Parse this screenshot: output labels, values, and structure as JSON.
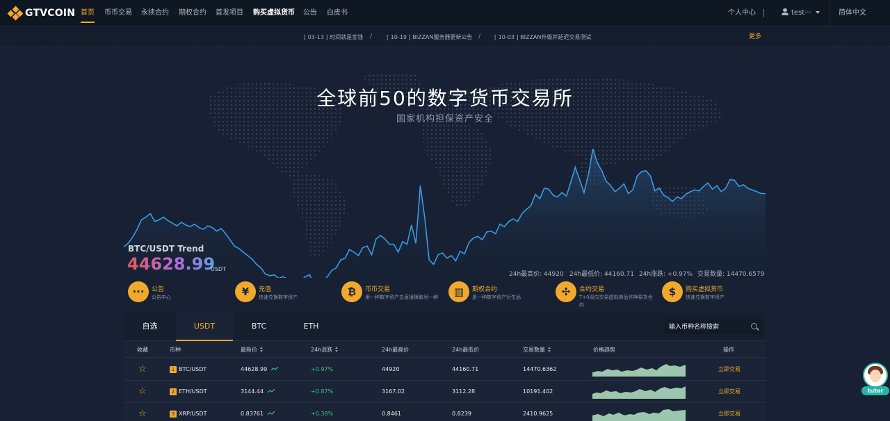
{
  "brand": {
    "name": "GTVCOIN"
  },
  "nav": {
    "items": [
      {
        "label": "首页"
      },
      {
        "label": "币币交易"
      },
      {
        "label": "永续合约"
      },
      {
        "label": "期权合约"
      },
      {
        "label": "首发项目"
      },
      {
        "label": "购买虚拟货币"
      },
      {
        "label": "公告"
      },
      {
        "label": "白皮书"
      }
    ],
    "personal_center": "个人中心",
    "user": "test···",
    "language": "简体中文"
  },
  "notices": {
    "items": [
      "[ 03-13 ] 时间就是金钱",
      "[ 10-19 ] BIZZAN服务器更新公告",
      "[ 10-03 ] BIZZAN升级并延迟交易测试"
    ],
    "separator": "/",
    "more": "更多"
  },
  "hero": {
    "title": "全球前50的数字货币交易所",
    "subtitle": "国家机构担保资产安全"
  },
  "trend": {
    "label": "BTC/USDT Trend",
    "price": "44628.99",
    "unit": "USDT",
    "high": "24h最高价: 44920",
    "low": "24h最低价: 44160.71",
    "change": "24h涨跌: +0.97%",
    "volume": "交易数量: 14470.6579",
    "line_color": "#3a9be3",
    "points": [
      1.8,
      2.2,
      2.9,
      3.8,
      4.9,
      5.2,
      5.6,
      4.7,
      4.9,
      5.2,
      4.8,
      4.5,
      4.2,
      4.6,
      4.3,
      4.1,
      4.4,
      4.0,
      3.8,
      4.2,
      4.0,
      3.6,
      3.9,
      3.3,
      2.6,
      1.9,
      1.6,
      1.2,
      0.8,
      0.4,
      -0.2,
      -0.6,
      -1.3,
      -1.5,
      -1.4,
      -1.8,
      -1.6,
      -1.9,
      -2.0,
      -1.8,
      -2.1,
      -1.6,
      -1.4,
      -2.6,
      -2.0,
      -2.2,
      -1.6,
      -0.9,
      -0.6,
      0.3,
      0.5,
      1.5,
      1.2,
      0.8,
      1.7,
      1.9,
      0.9,
      2.7,
      3.1,
      2.7,
      2.1,
      2.1,
      1.2,
      2.4,
      2.1,
      4.3,
      2.2,
      8.8,
      5.1,
      0.3,
      -0.2,
      0.9,
      1.1,
      0.5,
      0.8,
      0.2,
      1.3,
      1.0,
      2.3,
      2.8,
      3.0,
      2.6,
      3.5,
      3.6,
      3.3,
      4.4,
      4.1,
      4.7,
      5.0,
      4.7,
      5.6,
      6.1,
      6.5,
      7.8,
      7.3,
      8.5,
      8.4,
      7.7,
      7.5,
      8.0,
      7.6,
      9.2,
      10.9,
      9.5,
      8.0,
      10.1,
      13.0,
      11.4,
      10.5,
      9.3,
      8.8,
      8.1,
      8.5,
      9.0,
      7.9,
      8.3,
      9.9,
      10.4,
      10.5,
      9.9,
      8.2,
      8.5,
      7.7,
      7.4,
      7.0,
      7.5,
      7.3,
      7.8,
      8.1,
      8.3,
      8.2,
      8.7,
      9.1,
      8.4,
      8.8,
      8.1,
      8.5,
      9.5,
      9.4,
      8.7,
      8.9,
      8.5,
      8.3,
      8.1,
      7.9,
      7.9
    ]
  },
  "features": [
    {
      "icon": "chat-bubble-icon",
      "glyph": "···",
      "title": "公告",
      "desc": "公告中心"
    },
    {
      "icon": "yen-icon",
      "glyph": "¥",
      "title": "充值",
      "desc": "快速兑换数字资产"
    },
    {
      "icon": "bitcoin-icon",
      "glyph": "₿",
      "title": "币币交易",
      "desc": "用一种数字资产去直接换取另一种"
    },
    {
      "icon": "bar-chart-icon",
      "glyph": "▥",
      "title": "期权合约",
      "desc": "是一种数字资产衍生品"
    },
    {
      "icon": "network-icon",
      "glyph": "✣",
      "title": "合约交易",
      "desc": "T+0双向交易虚拟商品作押易货合约"
    },
    {
      "icon": "currency-exchange-icon",
      "glyph": "$",
      "title": "购买虚拟货币",
      "desc": "快速兑换数字资产"
    }
  ],
  "market": {
    "tabs": [
      "自选",
      "USDT",
      "BTC",
      "ETH"
    ],
    "active_tab": "USDT",
    "search_placeholder": "输入币种名称搜索",
    "columns": [
      "收藏",
      "币种",
      "最新价",
      "24h涨跌",
      "24h最高价",
      "24h最低价",
      "交易数量",
      "价格趋势",
      "操作"
    ],
    "rows": [
      {
        "rank": "1",
        "pair": "BTC/USDT",
        "price": "44628.99",
        "change": "+0.97%",
        "high": "44920",
        "low": "44160.71",
        "volume": "14470.6362",
        "action": "立即交易"
      },
      {
        "rank": "2",
        "pair": "ETH/USDT",
        "price": "3144.44",
        "change": "+0.87%",
        "high": "3167.02",
        "low": "3112.28",
        "volume": "10191.402",
        "action": "立即交易"
      },
      {
        "rank": "3",
        "pair": "XRP/USDT",
        "price": "0.83761",
        "change": "+0.38%",
        "high": "0.8461",
        "low": "0.8239",
        "volume": "2410.9625",
        "action": "立即交易"
      }
    ]
  },
  "tutor": {
    "label": "tutor"
  },
  "colors": {
    "accent": "#f0a92e",
    "up": "#3fc186",
    "background": "#172133"
  }
}
